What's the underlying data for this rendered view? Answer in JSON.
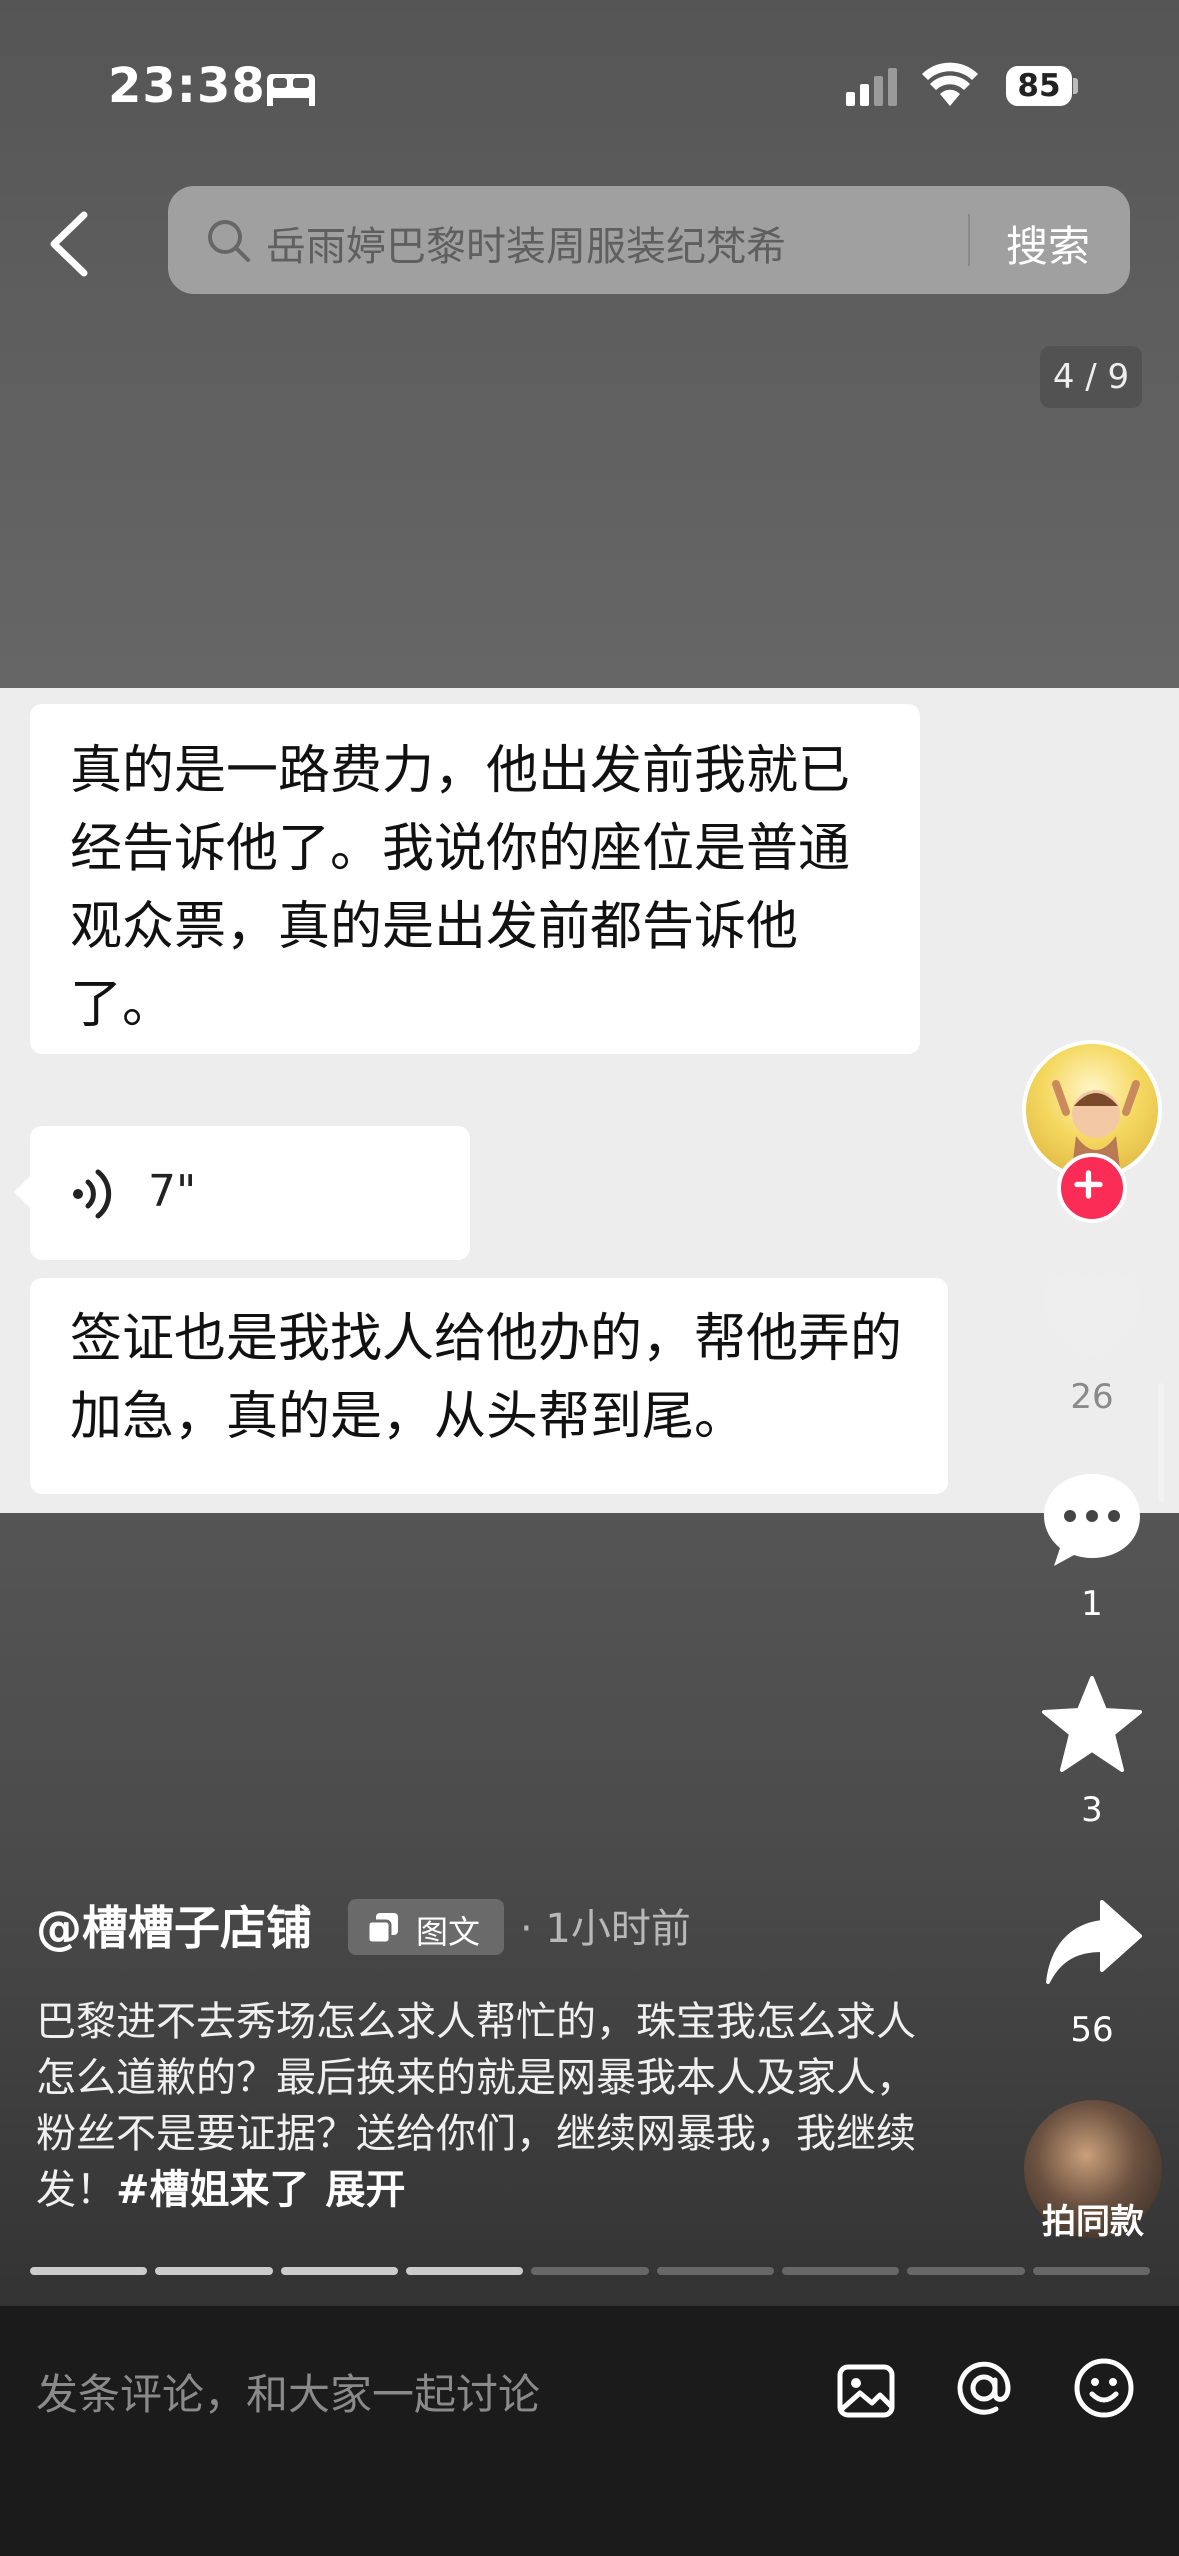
{
  "status_bar": {
    "time": "23:38",
    "battery": "85"
  },
  "header": {
    "search_text": "岳雨婷巴黎时装周服装纪梵希",
    "search_button": "搜索"
  },
  "page_indicator": "4 / 9",
  "chat": {
    "message_1": "真的是一路费力，他出发前我就已经告诉他了。我说你的座位是普通观众票，真的是出发前都告诉他了。",
    "voice_duration": "7\"",
    "message_3": "签证也是我找人给他办的，帮他弄的加急，真的是，从头帮到尾。"
  },
  "actions": {
    "likes": "26",
    "comments": "1",
    "favorites": "3",
    "shares": "56",
    "same_style_label": "拍同款"
  },
  "post": {
    "author": "@槽槽子店铺",
    "type_badge": "图文",
    "time": "· 1小时前",
    "caption": "巴黎进不去秀场怎么求人帮忙的，珠宝我怎么求人怎么道歉的？最后换来的就是网暴我本人及家人，粉丝不是要证据？送给你们，继续网暴我，我继续发！",
    "hashtag": "#槽姐来了",
    "expand": "展开",
    "progress": {
      "current": 4,
      "total": 9
    }
  },
  "comment_bar": {
    "placeholder": "发条评论，和大家一起讨论"
  }
}
